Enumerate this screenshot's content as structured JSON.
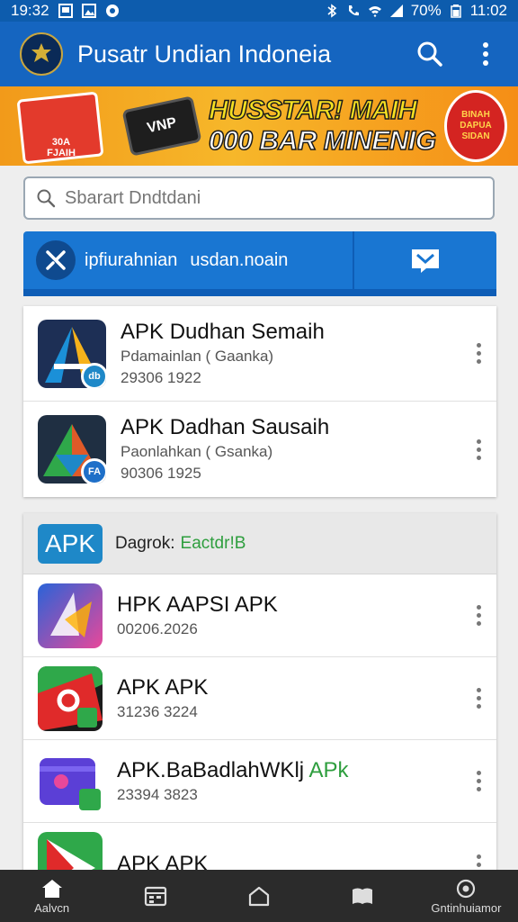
{
  "status_bar": {
    "time_left": "19:32",
    "battery": "70%",
    "time_right": "11:02"
  },
  "app_bar": {
    "title": "Pusatr Undian Indoneia"
  },
  "banner": {
    "box_text": "30A\nFJAIH",
    "card_text": "VNP",
    "headline_line1": "HUSSTAR! MAIH",
    "headline_line2": "000 BAR MINENIG",
    "seal_text": "BINAH DAPUA SIDAN"
  },
  "search": {
    "placeholder": "Sbarart Dndtdani"
  },
  "tabs": {
    "main_label_1": "ipfiurahnian",
    "main_label_2": "usdan.noain"
  },
  "apps_top": [
    {
      "title": "APK Dudhan Semaih",
      "subtitle": "Pdamainlan ( Gaanka)",
      "meta": "29306 1922"
    },
    {
      "title": "APK Dadhan Sausaih",
      "subtitle": "Paonlahkan ( Gsanka)",
      "meta": "90306 1925"
    }
  ],
  "section": {
    "logo": "APK",
    "label": "Dagrok:",
    "value": "Eactdr!B"
  },
  "apps_bottom": [
    {
      "title": "HPK AAPSI APK",
      "title_suffix": "",
      "meta": "00206.2026"
    },
    {
      "title": "APK APK",
      "title_suffix": "",
      "meta": "31236 3224"
    },
    {
      "title": "APK.BaBadlahWKlj ",
      "title_suffix": "APk",
      "meta": "23394 3823"
    },
    {
      "title": "APK APK",
      "title_suffix": "",
      "meta": ""
    }
  ],
  "bottom_nav": [
    {
      "label": "Aalvcn",
      "icon": "home-icon"
    },
    {
      "label": "",
      "icon": "calendar-icon"
    },
    {
      "label": "",
      "icon": "house-outline-icon"
    },
    {
      "label": "",
      "icon": "book-icon"
    },
    {
      "label": "Gntinhuiamor",
      "icon": "profile-icon"
    }
  ],
  "colors": {
    "primary": "#1565c0",
    "banner": "#f29a1a",
    "accent_green": "#2e9e3e"
  }
}
